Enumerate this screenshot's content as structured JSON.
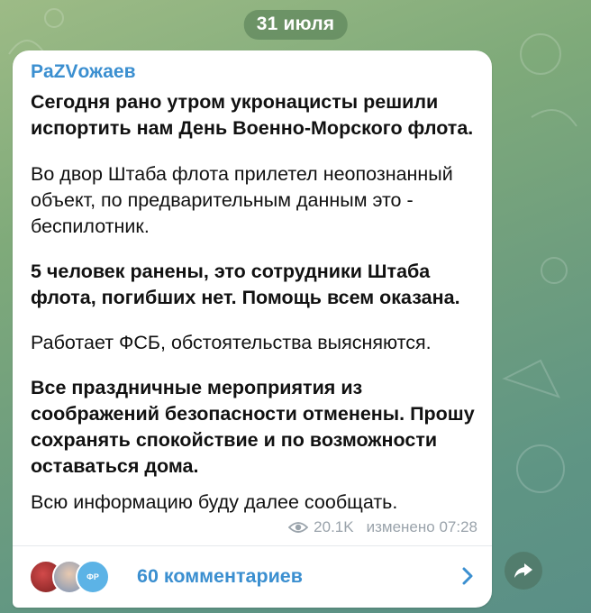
{
  "date_separator": "31 июля",
  "message": {
    "author": "PaZVожаев",
    "paragraphs": [
      {
        "text": "Сегодня рано утром укронацисты решили испортить нам День Военно-Морского флота.",
        "bold": true
      },
      {
        "text": "Во двор Штаба флота прилетел неопознанный объект, по предварительным данным это - беспилотник.",
        "bold": false
      },
      {
        "text": "5 человек ранены, это сотрудники Штаба флота, погибших нет. Помощь всем оказана.",
        "bold": true
      },
      {
        "text": "Работает ФСБ, обстоятельства выясняются.",
        "bold": false
      },
      {
        "text": "Все праздничные мероприятия из соображений безопасности отменены. Прошу сохранять спокойствие и по возможности оставаться дома.",
        "bold": true
      },
      {
        "text": "Всю информацию буду далее сообщать.",
        "bold": false
      }
    ],
    "views": "20.1K",
    "edited_label": "изменено 07:28"
  },
  "comments": {
    "label": "60 комментариев",
    "avatar_badge": "ФР"
  },
  "colors": {
    "accent": "#3b8fd0",
    "meta": "#9aa3ab"
  },
  "icons": {
    "views": "eye-icon",
    "open_comments": "chevron-right-icon",
    "share": "share-arrow-icon"
  }
}
